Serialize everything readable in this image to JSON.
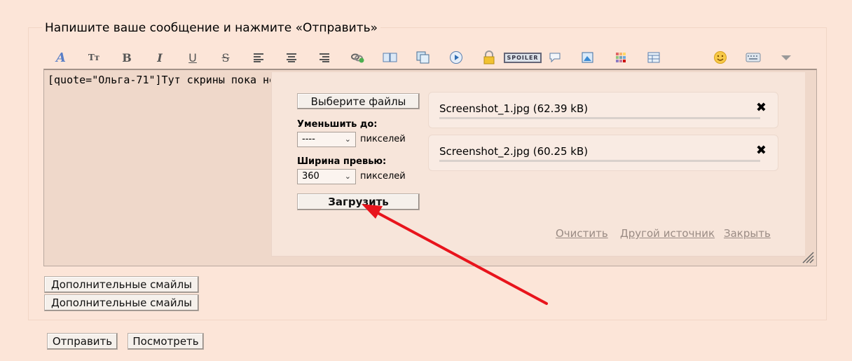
{
  "form": {
    "legend": "Напишите ваше сообщение и нажмите «Отправить»"
  },
  "toolbar": {
    "buttons": [
      {
        "name": "font-style-icon"
      },
      {
        "name": "font-size-icon",
        "glyph": "Tт"
      },
      {
        "name": "bold-icon",
        "glyph": "B"
      },
      {
        "name": "italic-icon",
        "glyph": "I"
      },
      {
        "name": "underline-icon",
        "glyph": "U"
      },
      {
        "name": "strikethrough-icon",
        "glyph": "S"
      },
      {
        "name": "align-left-icon"
      },
      {
        "name": "align-center-icon"
      },
      {
        "name": "align-right-icon"
      },
      {
        "name": "link-icon"
      },
      {
        "name": "book-icon"
      },
      {
        "name": "copy-icon"
      },
      {
        "name": "play-icon"
      },
      {
        "name": "lock-icon"
      },
      {
        "name": "spoiler-icon",
        "glyph": "SPOILER"
      },
      {
        "name": "speech-bubble-icon"
      },
      {
        "name": "image-icon"
      },
      {
        "name": "color-grid-icon"
      },
      {
        "name": "table-icon"
      },
      {
        "name": "smiley-icon"
      },
      {
        "name": "keyboard-icon"
      },
      {
        "name": "dropdown-triangle-icon"
      }
    ]
  },
  "editor": {
    "text": "[quote=\"Ольга-71\"]Тут скрины пока не"
  },
  "upload": {
    "choose_files": "Выберите файлы",
    "reduce_label": "Уменьшить до:",
    "reduce_value": "----",
    "pixels": "пикселей",
    "preview_label": "Ширина превью:",
    "preview_value": "360",
    "upload_button": "Загрузить",
    "files": [
      {
        "name": "Screenshot_1.jpg (62.39 kB)"
      },
      {
        "name": "Screenshot_2.jpg (60.25 kB)"
      }
    ],
    "close_glyph": "✖",
    "links": {
      "clear": "Очистить",
      "other_source": "Другой источник",
      "close": "Закрыть"
    }
  },
  "extras": {
    "smilies_1": "Дополнительные смайлы",
    "smilies_2": "Дополнительные смайлы"
  },
  "actions": {
    "send": "Отправить",
    "preview": "Посмотреть"
  },
  "colors": {
    "background": "#fce5d8",
    "editor_bg": "#efd8ca",
    "arrow": "#e8141c",
    "link": "#9a8b84"
  }
}
